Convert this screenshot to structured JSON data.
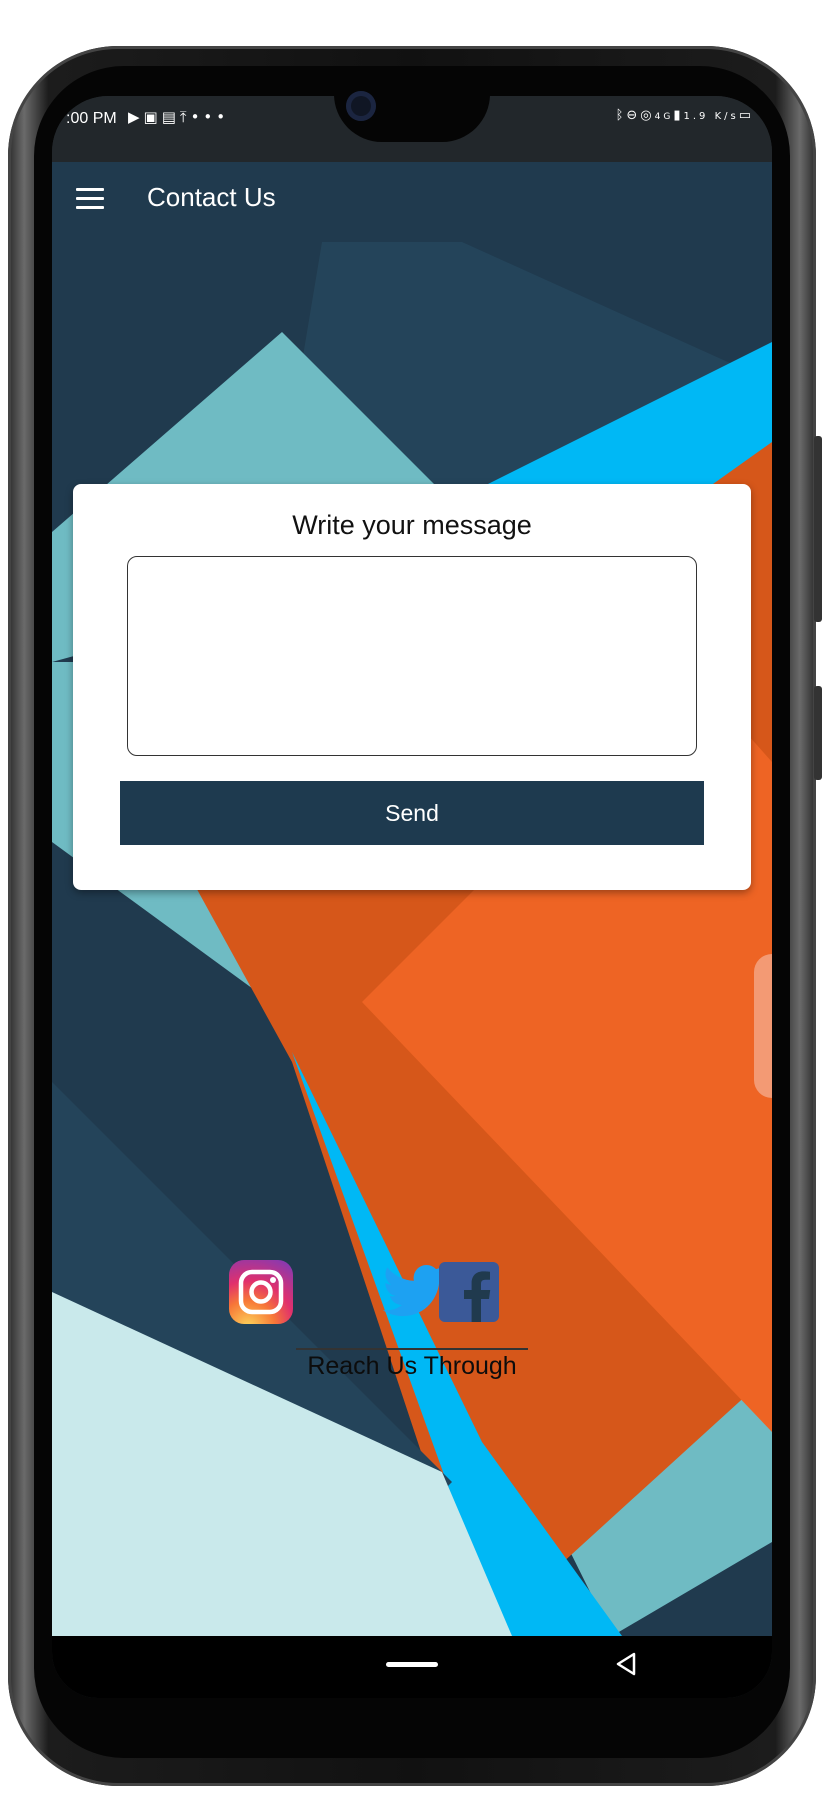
{
  "status_bar": {
    "time": ":00 PM",
    "left_icons": [
      "play-store-icon",
      "gallery-icon",
      "sim-icon",
      "upload-icon",
      "more-dots-icon"
    ],
    "right_icons": [
      "bluetooth-icon",
      "dnd-icon",
      "hotspot-icon",
      "signal-icon",
      "battery-icon"
    ],
    "network_speed": "1.9 K/s",
    "network_type": "4G"
  },
  "app_bar": {
    "title": "Contact Us",
    "menu_icon": "hamburger-menu-icon"
  },
  "message_card": {
    "title": "Write your message",
    "input_value": "",
    "send_label": "Send"
  },
  "socials": {
    "items": [
      {
        "name": "instagram",
        "icon": "instagram-icon"
      },
      {
        "name": "twitter",
        "icon": "twitter-icon"
      },
      {
        "name": "facebook",
        "icon": "facebook-icon"
      }
    ],
    "caption": "Reach Us Through"
  },
  "colors": {
    "primary": "#203a4e",
    "teal": "#6fbbc3",
    "sky": "#00b8f5",
    "orange": "#ee6424",
    "dark_orange": "#d6571a",
    "pale": "#c9e9eb"
  },
  "nav_bar": {
    "home": "home-pill",
    "back": "back-triangle-icon"
  }
}
